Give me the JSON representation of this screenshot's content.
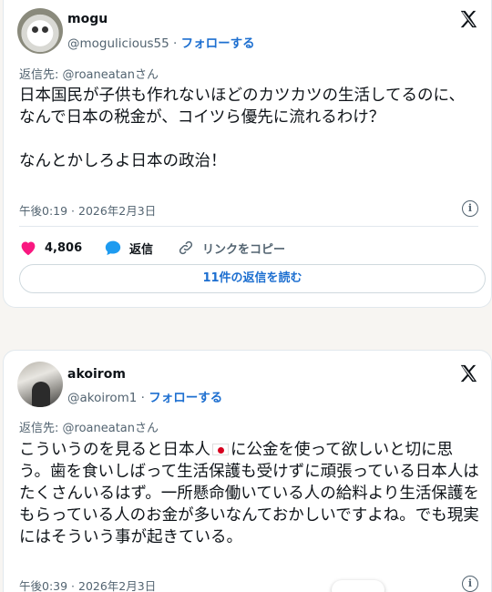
{
  "tweets": [
    {
      "name": "mogu",
      "handle": "@mogulicious55",
      "separator": " · ",
      "follow_label": "フォローする",
      "reply_to": "返信先: @roaneatanさん",
      "text": "日本国民が子供も作れないほどのカツカツの生活してるのに、なんで日本の税金が、コイツら優先に流れるわけ？\n\nなんとかしろよ日本の政治！",
      "time": "午後0:19 · 2026年2月3日",
      "likes": "4,806",
      "reply_label": "返信",
      "copy_link_label": "リンクをコピー",
      "read_replies_label": "11件の返信を読む"
    },
    {
      "name": "akoirom",
      "handle": "@akoirom1",
      "separator": " · ",
      "follow_label": "フォローする",
      "reply_to": "返信先: @roaneatanさん",
      "text_before_flag": "こういうのを見ると日本人",
      "flag_icon": "japan-flag-emoji",
      "text_after_flag": "に公金を使って欲しいと切に思う。歯を食いしばって生活保護も受けずに頑張っている日本人はたくさんいるはず。一所懸命働いている人の給料より生活保護をもらっている人のお金が多いなんておかしいですよね。でも現実にはそういう事が起きている。",
      "time": "午後0:39 · 2026年2月3日"
    }
  ],
  "colors": {
    "link_blue": "#1d6fd0",
    "like_pink": "#f91880",
    "reply_blue": "#1d9bf0",
    "muted": "#536471"
  }
}
